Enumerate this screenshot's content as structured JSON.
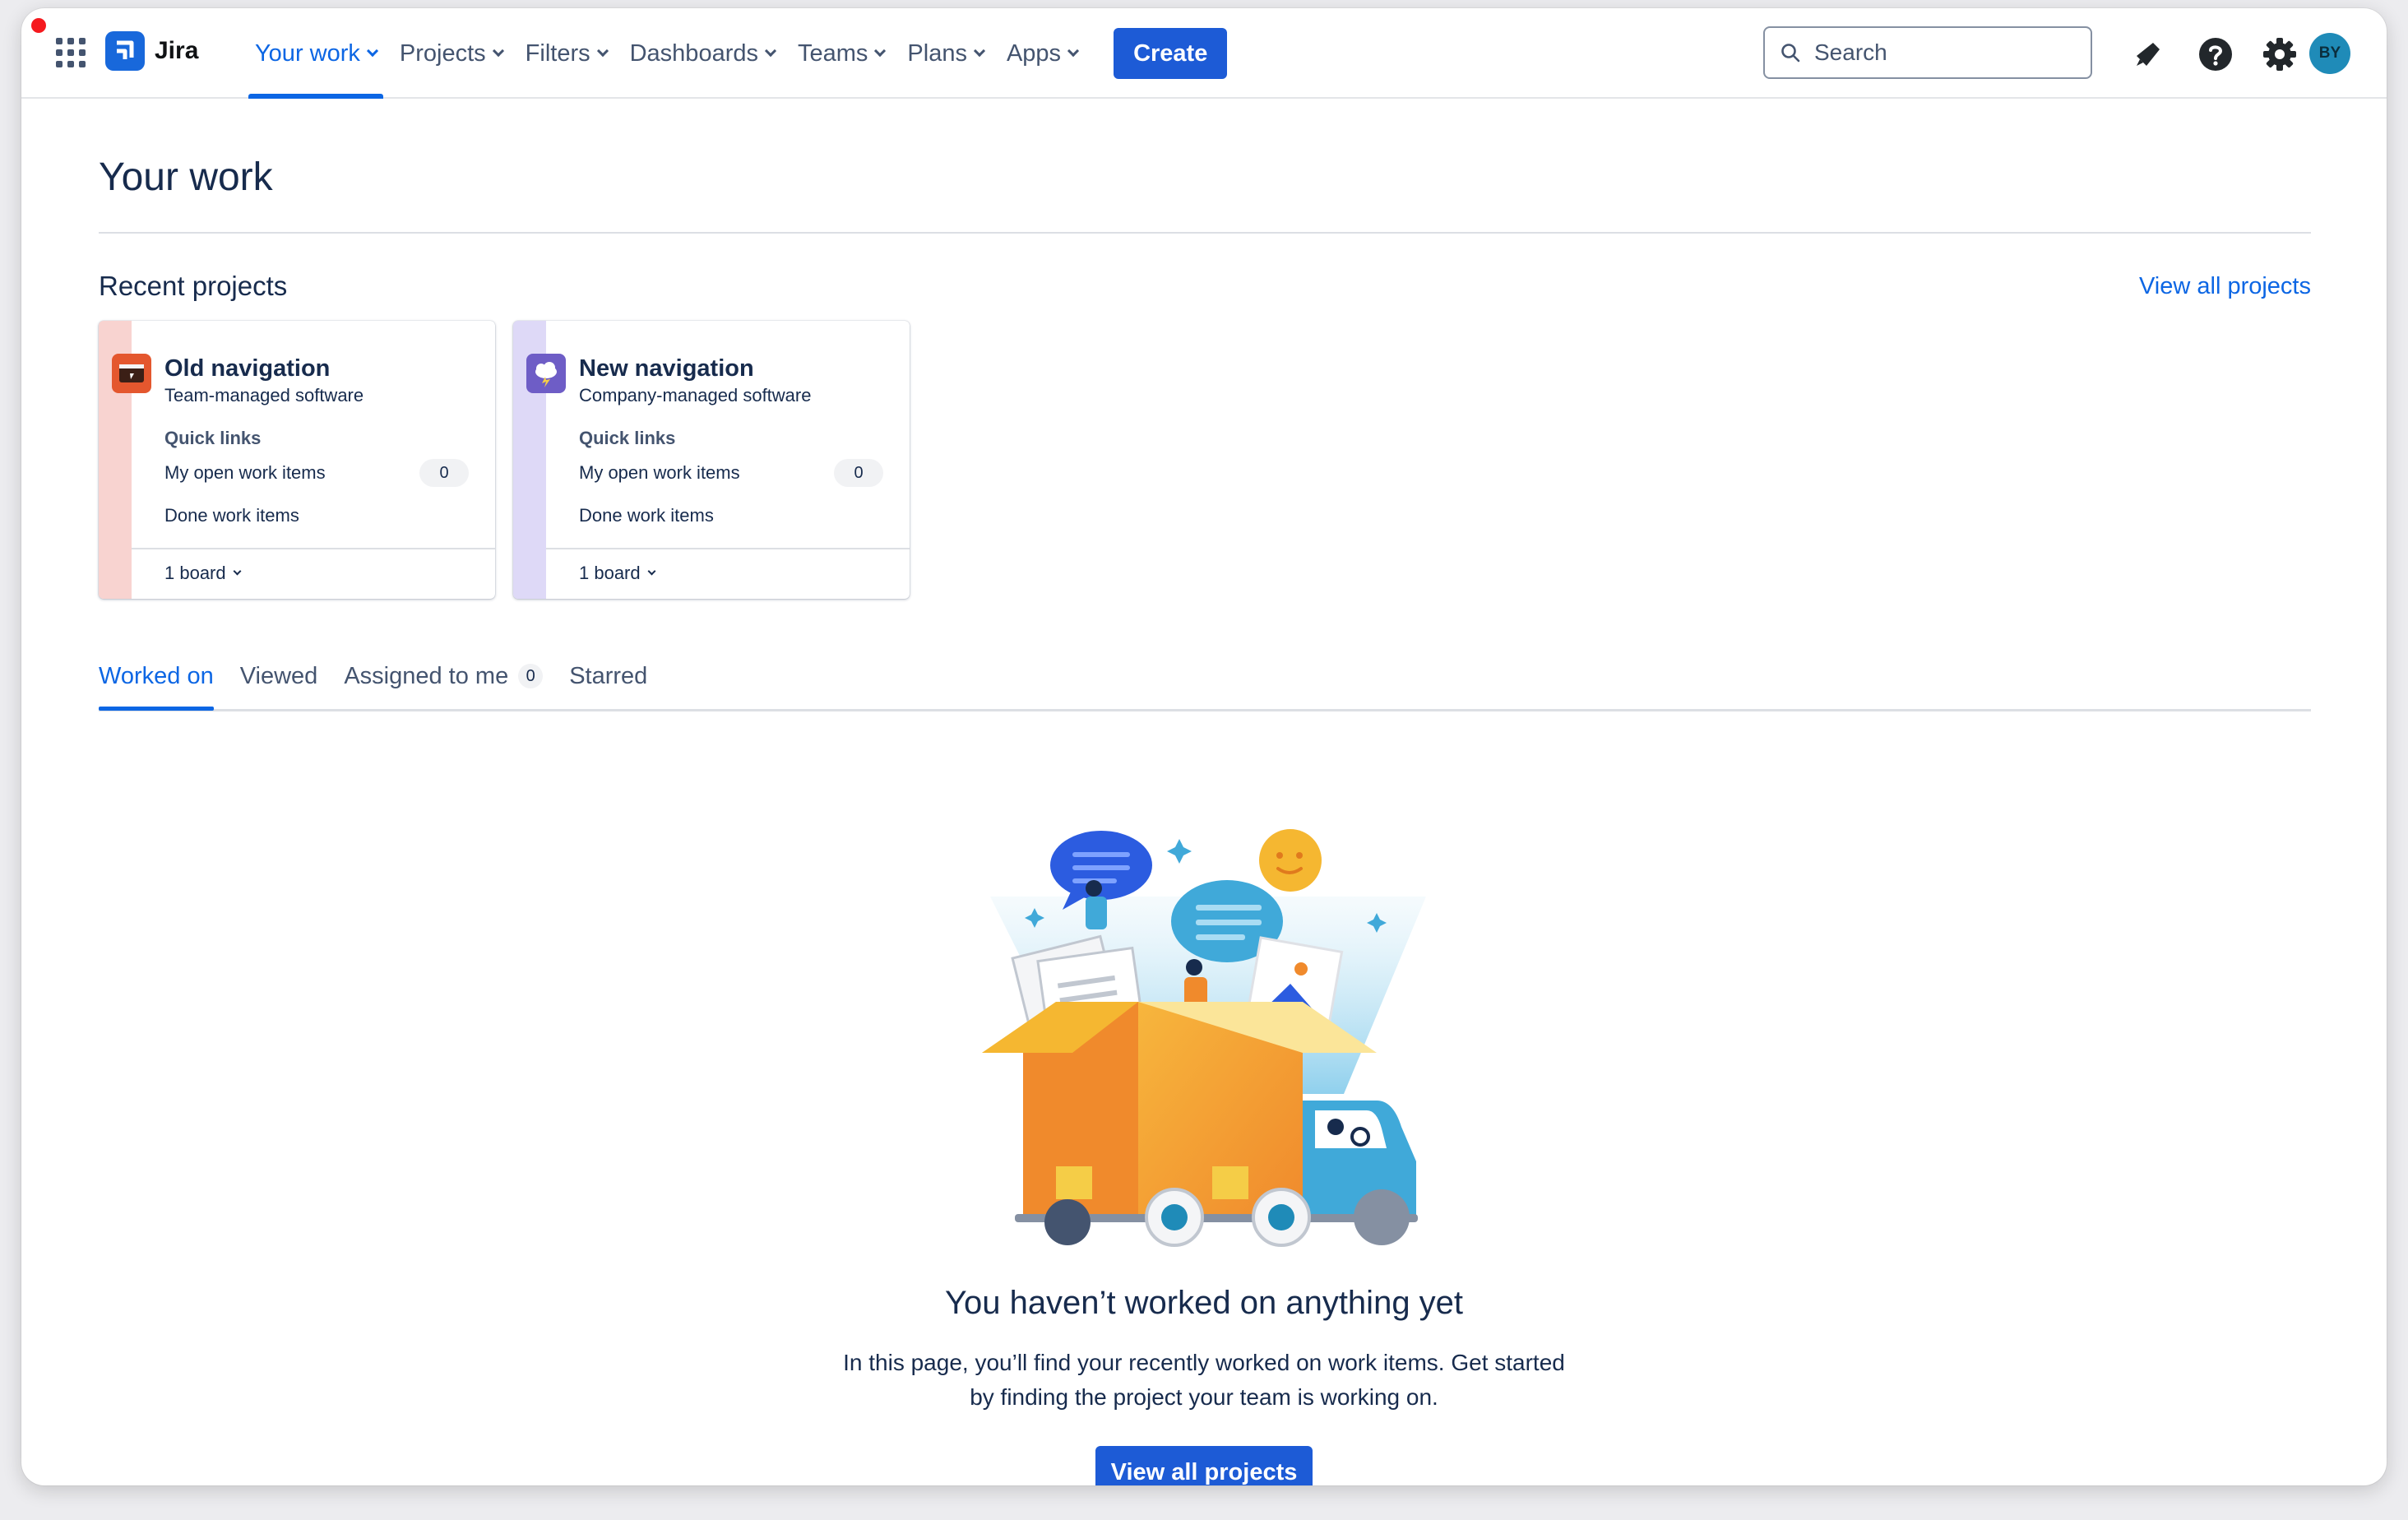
{
  "app": {
    "name": "Jira",
    "logo_icon": "jira-logo-icon",
    "apps_icon": "app-switcher-grid-icon"
  },
  "nav": {
    "items": [
      {
        "label": "Your work",
        "active": true
      },
      {
        "label": "Projects"
      },
      {
        "label": "Filters"
      },
      {
        "label": "Dashboards"
      },
      {
        "label": "Teams"
      },
      {
        "label": "Plans"
      },
      {
        "label": "Apps"
      }
    ],
    "create_label": "Create"
  },
  "search": {
    "placeholder": "Search"
  },
  "user": {
    "initials": "BY"
  },
  "colors": {
    "brand": "#1868db",
    "accent": "#0c66e4",
    "button": "#1d5bd6",
    "text": "#172b4d"
  },
  "page": {
    "title": "Your work"
  },
  "recent": {
    "title": "Recent projects",
    "view_all": "View all projects",
    "projects": [
      {
        "name": "Old navigation",
        "type": "Team-managed software",
        "quick_links": "Quick links",
        "open_items": "My open work items",
        "open_count": "0",
        "done_items": "Done work items",
        "boards": "1 board",
        "stripe_color": "#f8d3d0",
        "icon_color": "#e4572e"
      },
      {
        "name": "New navigation",
        "type": "Company-managed software",
        "quick_links": "Quick links",
        "open_items": "My open work items",
        "open_count": "0",
        "done_items": "Done work items",
        "boards": "1 board",
        "stripe_color": "#ded9f7",
        "icon_color": "#6e5dc6"
      }
    ]
  },
  "tabs": [
    {
      "label": "Worked on",
      "active": true
    },
    {
      "label": "Viewed"
    },
    {
      "label": "Assigned to me",
      "count": "0"
    },
    {
      "label": "Starred"
    }
  ],
  "empty": {
    "title": "You haven’t worked on anything yet",
    "line1": "In this page, you’ll find your recently worked on work items. Get started",
    "line2": "by finding the project your team is working on.",
    "cta": "View all projects"
  }
}
